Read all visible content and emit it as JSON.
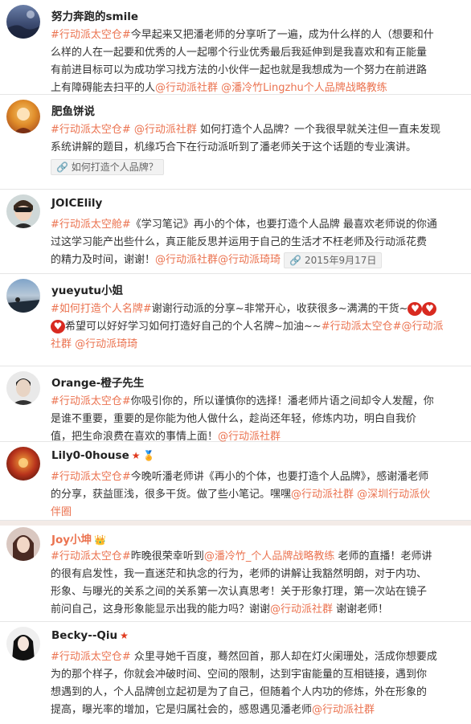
{
  "posts": [
    {
      "user": "努力奔跑的smile",
      "lines": [
        "#行动派太空仓#今早起来又把潘老师的分享听了一遍，成为什么样的人（想要和什",
        "么样的人在一起要和优秀的人一起哪个行业优秀最后我延伸到是我喜欢和有正能量",
        "有前进目标可以为成功学习找方法的小伙伴一起也就是我想成为一个努力在前进路",
        "上有障碍能去扫平的人@行动派社群 @潘冷竹Lingzhu个人品牌战略教练"
      ]
    },
    {
      "user": "肥鱼饼说",
      "lines": [
        "#行动派太空仓# @行动派社群 如何打造个人品牌？一个我很早就关注但一直未发现",
        "系统讲解的题目，机缘巧合下在行动派听到了潘老师关于这个话题的专业演讲。"
      ],
      "chip": "如何打造个人品牌？"
    },
    {
      "user": "JOICElily",
      "lines": [
        "#行动派太空舱#《学习笔记》再小的个体，也要打造个人品牌 最喜欢老师说的你通",
        "过这学习能产出些什么，真正能反思并运用于自己的生活才不枉老师及行动派花费",
        "的精力及时间，谢谢！@行动派社群@行动派琦琦"
      ],
      "chip": "2015年9月17日"
    },
    {
      "user": "yueyutu小姐",
      "lines": [
        "#如何打造个人名牌#谢谢行动派的分享~非常开心，收获很多~满满的干货~",
        "希望可以好好学习如何打造好自己的个人名牌~加油~~#行动派太空仓#@行动派",
        "社群 @行动派琦琦"
      ]
    },
    {
      "user": "Orange-橙子先生",
      "lines": [
        "#行动派太空仓#你吸引你的，所以谨慎你的选择！潘老师片语之间却令人发醒，你",
        "是谁不重要，重要的是你能为他人做什么，趁尚还年轻，修炼内功，明白自我价",
        "值，把生命浪费在喜欢的事情上面！@行动派社群"
      ]
    },
    {
      "user": "Lily0-0house",
      "lines": [
        "#行动派太空仓#今晚听潘老师讲《再小的个体，也要打造个人品牌》，感谢潘老师",
        "的分享，获益匪浅，很多干货。做了些小笔记。嘿嘿@行动派社群 @深圳行动派伙",
        "伴圈"
      ]
    },
    {
      "user": "Joy小坤",
      "lines": [
        "#行动派太空仓#昨晚很荣幸听到@潘冷竹_个人品牌战略教练 老师的直播！老师讲",
        "的很有启发性，我一直迷茫和执念的行为，老师的讲解让我豁然明朗，对于内功、",
        "形象、与曝光的关系之间的关系第一次认真思考！关于形象打理，第一次站在镜子",
        "前问自己，这身形象能显示出我的能力吗？谢谢@行动派社群 谢谢老师！"
      ]
    },
    {
      "user": "Becky--Qiu",
      "lines": [
        "#行动派太空仓# 众里寻她千百度，蓦然回首，那人却在灯火阑珊处，活成你想要成",
        "为的那个样子，你就会冲破时间、空间的限制，达到宇宙能量的互相链接，遇到你",
        "想遇到的人，个人品牌创立起初是为了自己，但随着个人内功的修炼，外在形象的",
        "提高，曝光率的增加，它是归属社会的，感恩遇见潘老师@行动派社群"
      ]
    }
  ],
  "colors": {
    "accent": "#eb7350",
    "text": "#333333"
  }
}
